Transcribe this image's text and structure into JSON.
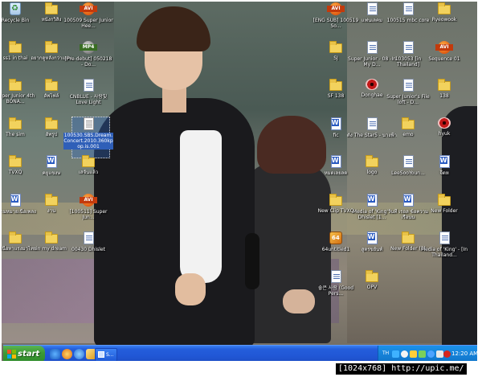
{
  "desktop": {
    "icons": [
      {
        "label": "Recycle Bin",
        "type": "recycle"
      },
      {
        "label": "หนังกวิ้สิ่ง",
        "type": "folder"
      },
      {
        "label": "100509 Super Junior Hee...",
        "type": "avi"
      },
      {
        "label": "ss1 in thai",
        "type": "folder"
      },
      {
        "label": "อยากดูหลังกว่าแฟน",
        "type": "folder"
      },
      {
        "label": "[Pre-debut] 050218 - Do...",
        "type": "mp4"
      },
      {
        "label": "Super Junior 4th BONA...",
        "type": "folder"
      },
      {
        "label": "อัพโฟล์",
        "type": "folder"
      },
      {
        "label": "CNBLUE - 사랑빛 Love Light",
        "type": "doc"
      },
      {
        "label": "The sim",
        "type": "folder"
      },
      {
        "label": "อัพรูป",
        "type": "folder"
      },
      {
        "label": "100530.SBS.Dream.Concert.2010.360kpop.is.001",
        "type": "txt"
      },
      {
        "label": "TVXQ",
        "type": "folder"
      },
      {
        "label": "คยูแขงษ",
        "type": "word"
      },
      {
        "label": "เสจันแล้ว",
        "type": "folder"
      },
      {
        "label": "ความหมายเนื้อเพลง",
        "type": "word"
      },
      {
        "label": "งาน",
        "type": "folder"
      },
      {
        "label": "[100511] Super Jun...",
        "type": "avi"
      },
      {
        "label": "ชมเนื้อหาแรงมาไทย",
        "type": "folder"
      },
      {
        "label": "in my dream",
        "type": "folder"
      },
      {
        "label": "00430 Dhislet",
        "type": "doc"
      },
      {
        "label": "[ENG SUB] 100519 So...",
        "type": "avi"
      },
      {
        "label": "แฟนเลคม",
        "type": "doc"
      },
      {
        "label": "100515 mbc core",
        "type": "doc"
      },
      {
        "label": "Ryeowook",
        "type": "folder"
      },
      {
        "label": "SJ",
        "type": "folder"
      },
      {
        "label": "Super Junior - 08 -In My D...",
        "type": "doc"
      },
      {
        "label": "103053 [in Thailand]",
        "type": "doc"
      },
      {
        "label": "Sequence 01",
        "type": "avi"
      },
      {
        "label": "SF 138",
        "type": "folder"
      },
      {
        "label": "Donghae",
        "type": "eye"
      },
      {
        "label": "Super Junior's File loft - D...",
        "type": "doc"
      },
      {
        "label": "138",
        "type": "folder"
      },
      {
        "label": "fic",
        "type": "word"
      },
      {
        "label": "ดั้ง The Star5 - นางฟ้า",
        "type": "doc"
      },
      {
        "label": "emo",
        "type": "folder"
      },
      {
        "label": "hyuk",
        "type": "eye"
      },
      {
        "label": "หมดเลยลด",
        "type": "word"
      },
      {
        "label": "logo",
        "type": "folder"
      },
      {
        "label": "LeeSooYoun...",
        "type": "doc"
      },
      {
        "label": "จี๊ดห",
        "type": "word"
      },
      {
        "label": "New Clip TVXQ",
        "type": "folder"
      },
      {
        "label": "Media of 'King' - Dhislet [1...",
        "type": "word"
      },
      {
        "label": "วันที่ เรอล ข้อความ เรือนน",
        "type": "word"
      },
      {
        "label": "New Folder",
        "type": "folder"
      },
      {
        "label": "64untitled1",
        "type": "app"
      },
      {
        "label": "สูตรขยันท์",
        "type": "word"
      },
      {
        "label": "New Folder (3)",
        "type": "folder"
      },
      {
        "label": "Media of 'King' - [In Thailand...",
        "type": "doc"
      },
      {
        "label": "좋은 사람 (Good Pers...",
        "type": "doc"
      },
      {
        "label": "OPV",
        "type": "folder"
      }
    ]
  },
  "taskbar": {
    "start_label": "start",
    "task_item_label": "S...",
    "tray_lang": "TH",
    "clock": "12:20 AM"
  },
  "watermark": "[1024x768] http://upic.me/"
}
